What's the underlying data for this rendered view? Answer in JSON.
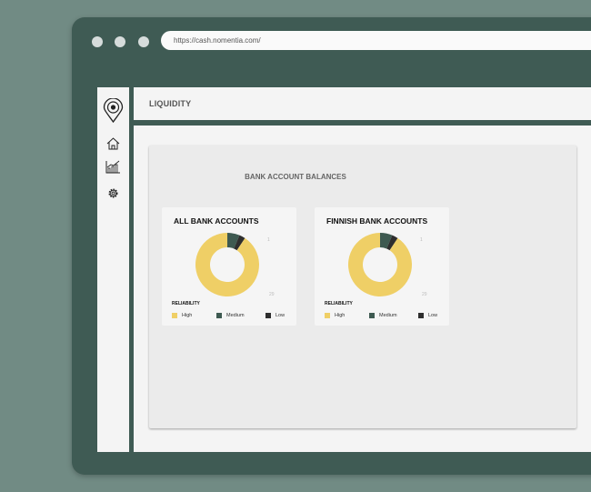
{
  "browser": {
    "url": "https://cash.nomentia.com/"
  },
  "sidebar": {
    "items": [
      {
        "icon": "logo-pin-icon"
      },
      {
        "icon": "home-icon"
      },
      {
        "icon": "chart-icon"
      },
      {
        "icon": "gear-icon"
      }
    ]
  },
  "header": {
    "title": "LIQUIDITY"
  },
  "panel": {
    "title": "BANK ACCOUNT BALANCES"
  },
  "colors": {
    "high": "#efcf66",
    "medium": "#3e5a51",
    "low": "#2e2e2e"
  },
  "cards": [
    {
      "title": "ALL BANK ACCOUNTS",
      "tick_top": "1",
      "tick_bottom": "29",
      "legend_title": "RELIABILITY",
      "legend": {
        "high": "High",
        "medium": "Medium",
        "low": "Low"
      }
    },
    {
      "title": "FINNISH BANK ACCOUNTS",
      "tick_top": "1",
      "tick_bottom": "29",
      "legend_title": "RELIABILITY",
      "legend": {
        "high": "High",
        "medium": "Medium",
        "low": "Low"
      }
    }
  ],
  "chart_data": [
    {
      "type": "pie",
      "title": "ALL BANK ACCOUNTS",
      "categories": [
        "High",
        "Medium",
        "Low"
      ],
      "values": [
        29,
        2,
        1
      ]
    },
    {
      "type": "pie",
      "title": "FINNISH BANK ACCOUNTS",
      "categories": [
        "High",
        "Medium",
        "Low"
      ],
      "values": [
        29,
        2,
        1
      ]
    }
  ]
}
